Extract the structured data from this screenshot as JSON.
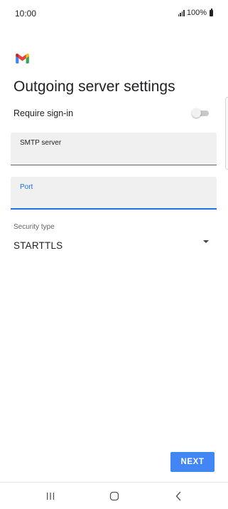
{
  "status_bar": {
    "time": "10:00",
    "battery": "100%"
  },
  "logo": {
    "icon": "gmail-logo",
    "colors": [
      "#4285f4",
      "#ea4335",
      "#fbbc04",
      "#34a853",
      "#c5221f"
    ]
  },
  "page": {
    "title": "Outgoing server settings"
  },
  "require_signin": {
    "label": "Require sign-in",
    "enabled": false
  },
  "fields": {
    "smtp_server": {
      "label": "SMTP server",
      "value": ""
    },
    "port": {
      "label": "Port",
      "value": "",
      "focused": true
    }
  },
  "security": {
    "label": "Security type",
    "value": "STARTTLS"
  },
  "actions": {
    "next_label": "NEXT",
    "accent_color": "#4285f4"
  },
  "nav_bar": {
    "items": [
      "recents-icon",
      "home-icon",
      "back-icon"
    ]
  }
}
